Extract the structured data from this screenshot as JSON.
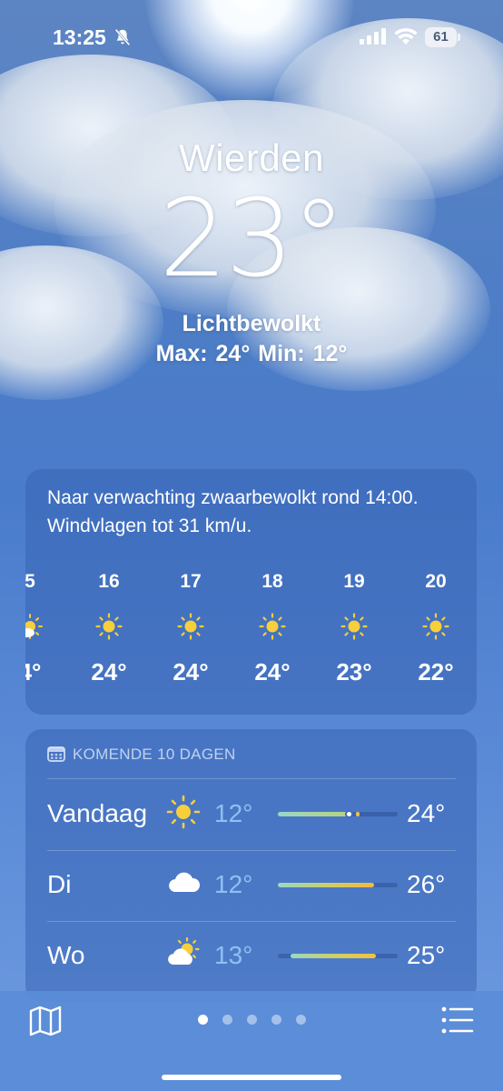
{
  "status_bar": {
    "time": "13:25",
    "battery": "61",
    "icons": [
      "bell-slash-icon",
      "cellular-signal-icon",
      "wifi-icon",
      "battery-icon"
    ]
  },
  "location": {
    "city": "Wierden",
    "temperature": "23°",
    "condition": "Lichtbewolkt",
    "high_low": "Max: 24°  Min: 12°"
  },
  "hourly_forecast": {
    "summary": "Naar verwachting zwaarbewolkt rond 14:00. Windvlagen tot 31 km/u.",
    "hours": [
      {
        "hour": "5",
        "icon": "partly-sunny-icon",
        "temp": "4°"
      },
      {
        "hour": "16",
        "icon": "sun-icon",
        "temp": "24°"
      },
      {
        "hour": "17",
        "icon": "sun-icon",
        "temp": "24°"
      },
      {
        "hour": "18",
        "icon": "sun-icon",
        "temp": "24°"
      },
      {
        "hour": "19",
        "icon": "sun-icon",
        "temp": "23°"
      },
      {
        "hour": "20",
        "icon": "sun-icon",
        "temp": "22°"
      }
    ]
  },
  "daily_forecast": {
    "header": "KOMENDE 10 DAGEN",
    "header_icon": "calendar-icon",
    "days": [
      {
        "day": "Vandaag",
        "icon": "sun-icon",
        "low": "12°",
        "high": "24°",
        "range_start": 0.0,
        "range_end": 0.6,
        "current_marker": 0.58
      },
      {
        "day": "Di",
        "icon": "cloud-icon",
        "low": "12°",
        "high": "26°",
        "range_start": 0.0,
        "range_end": 0.8
      },
      {
        "day": "Wo",
        "icon": "partly-cloudy-icon",
        "low": "13°",
        "high": "25°",
        "range_start": 0.1,
        "range_end": 0.82
      }
    ]
  },
  "bottom_bar": {
    "map_icon": "map-icon",
    "list_icon": "list-icon",
    "page_count": 5,
    "active_page": 1
  },
  "colors": {
    "sun": "#f6cf3a",
    "low_temp": "#8fc0f2",
    "range_gradient_start": "#9ad7c7",
    "range_gradient_end": "#f5b93c"
  }
}
